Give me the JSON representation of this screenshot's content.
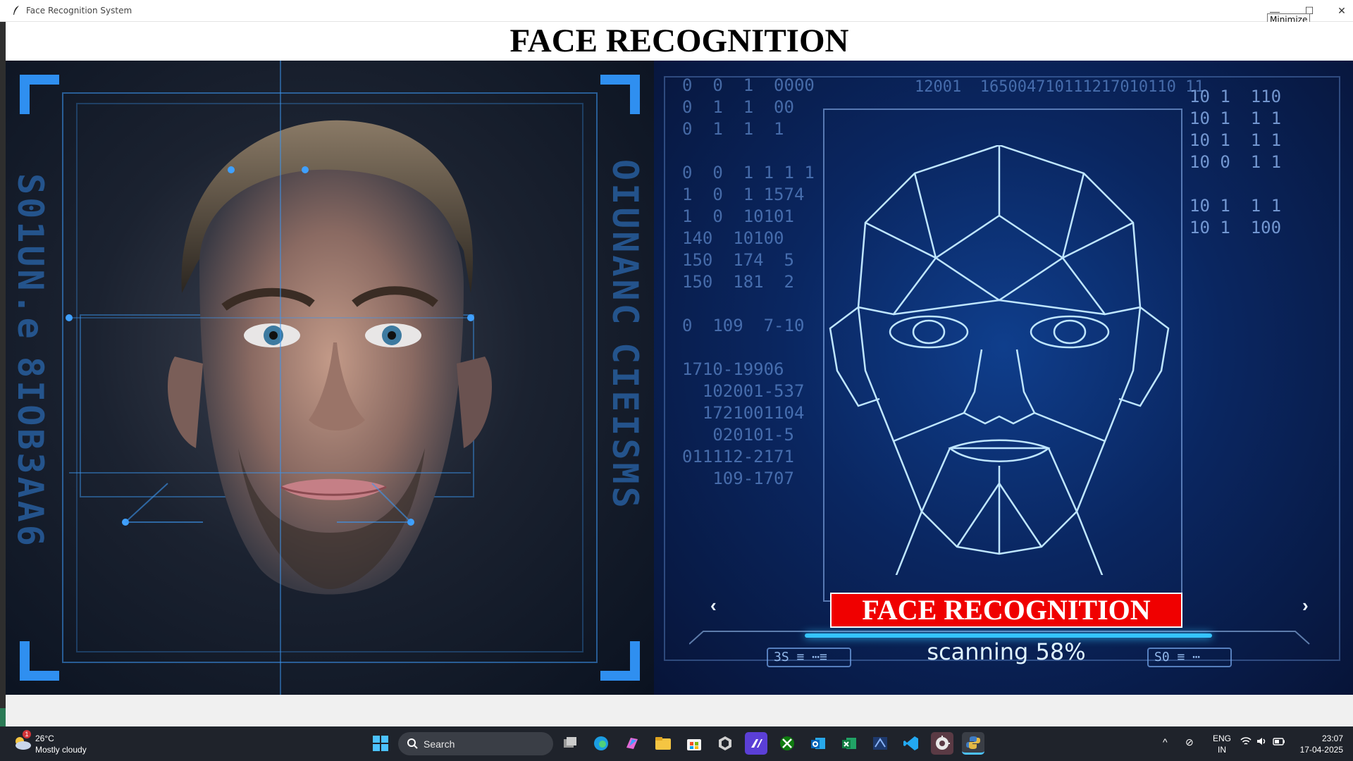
{
  "window": {
    "title": "Face Recognition System",
    "tooltip": "Minimize",
    "minimize_glyph": "—",
    "maximize_glyph": "☐",
    "close_glyph": "✕"
  },
  "app": {
    "heading": "FACE RECOGNITION"
  },
  "banner": {
    "left_side_text_1": "S01UN.e",
    "left_side_text_2": "8IOB3AA6",
    "right_side_text_1": "OIUNANC",
    "right_side_text_2": "CIEISMS",
    "code_left": "0  0  1  0000\n0  1  1  00\n0  1  1  1\n\n0  0  1 1 1 1\n1  0  1 1574\n1  0  10101\n140  10100\n150  174  5\n150  181  2\n\n0  109  7-10\n\n1710-19906\n  102001-537\n  1721001104\n   020101-5\n011112-2171\n   109-1707",
    "code_top": "12001  165004710111217010110 11",
    "code_right": "10 1  110\n10 1  1 1\n10 1  1 1\n10 0  1 1\n\n10 1  1 1\n10 1  100",
    "label": "FACE RECOGNITION",
    "scan_text": "scanning 58%",
    "scan_progress": 0.58,
    "chip_left": "3S ≡  ⋯≡",
    "chip_right": "S0  ≡ ⋯",
    "prev_glyph": "‹",
    "next_glyph": "›",
    "accent_color": "#35c4ff",
    "label_color": "#f00000"
  },
  "taskbar": {
    "weather_temp": "26°C",
    "weather_desc": "Mostly cloudy",
    "weather_badge": "1",
    "search_label": "Search",
    "tray_chevron": "^",
    "lang_line1": "ENG",
    "lang_line2": "IN",
    "time": "23:07",
    "date": "17-04-2025",
    "icons": [
      "windows-start-icon",
      "task-view-icon",
      "edge-icon",
      "copilot-icon",
      "file-explorer-icon",
      "microsoft-store-icon",
      "github-icon",
      "visual-studio-icon",
      "xbox-icon",
      "outlook-icon",
      "excel-icon",
      "sql-server-icon",
      "vscode-icon",
      "settings-gear-app-icon",
      "python-icon"
    ]
  }
}
